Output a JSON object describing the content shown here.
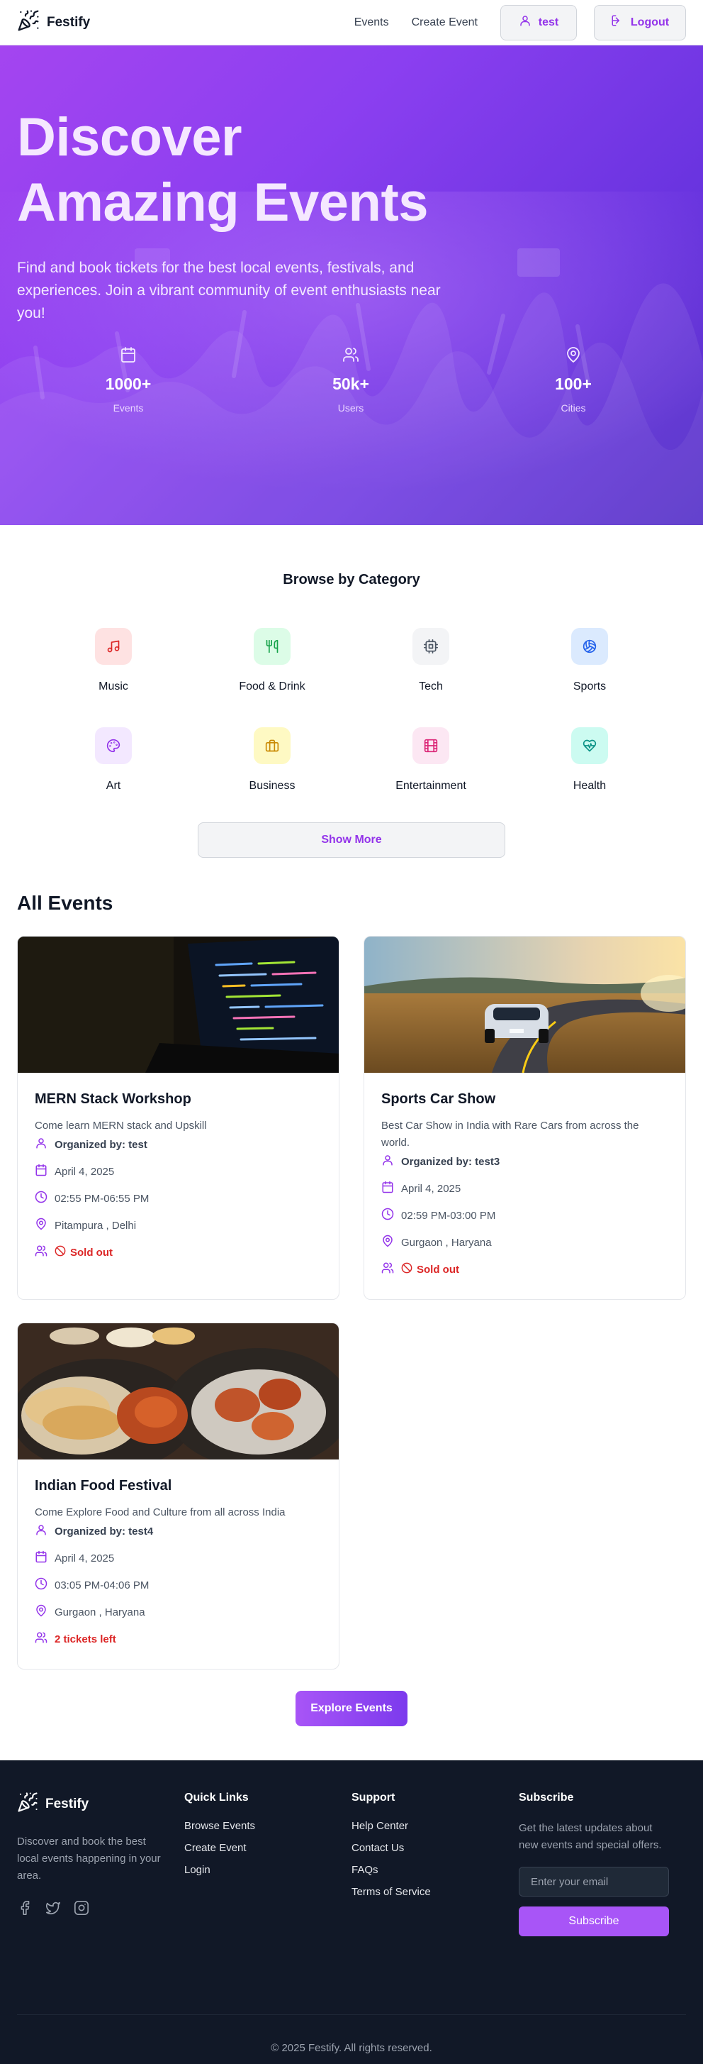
{
  "header": {
    "brand": "Festify",
    "nav": [
      "Events",
      "Create Event"
    ],
    "user_label": "test",
    "logout_label": "Logout"
  },
  "hero": {
    "title_line1": "Discover",
    "title_line2": "Amazing Events",
    "subtitle": "Find and book tickets for the best local events, festivals, and experiences. Join a vibrant community of event enthusiasts near you!",
    "stats": [
      {
        "icon": "calendar-icon",
        "value": "1000+",
        "label": "Events"
      },
      {
        "icon": "users-icon",
        "value": "50k+",
        "label": "Users"
      },
      {
        "icon": "map-pin-icon",
        "value": "100+",
        "label": "Cities"
      }
    ]
  },
  "categories": {
    "title": "Browse by Category",
    "items": [
      {
        "label": "Music",
        "icon": "music-icon",
        "bg": "#fee2e2",
        "fg": "#dc2626"
      },
      {
        "label": "Food & Drink",
        "icon": "utensils-icon",
        "bg": "#dcfce7",
        "fg": "#16a34a"
      },
      {
        "label": "Tech",
        "icon": "cpu-icon",
        "bg": "#f3f4f6",
        "fg": "#4b5563"
      },
      {
        "label": "Sports",
        "icon": "volleyball-icon",
        "bg": "#dbeafe",
        "fg": "#2563eb"
      },
      {
        "label": "Art",
        "icon": "palette-icon",
        "bg": "#f3e8ff",
        "fg": "#9333ea"
      },
      {
        "label": "Business",
        "icon": "briefcase-icon",
        "bg": "#fef9c3",
        "fg": "#ca8a04"
      },
      {
        "label": "Entertainment",
        "icon": "film-icon",
        "bg": "#fce7f3",
        "fg": "#db2777"
      },
      {
        "label": "Health",
        "icon": "heart-pulse-icon",
        "bg": "#ccfbf1",
        "fg": "#0d9488"
      }
    ],
    "show_more": "Show More"
  },
  "events": {
    "title": "All Events",
    "items": [
      {
        "title": "MERN Stack Workshop",
        "description": "Come learn MERN stack and Upskill",
        "organizer": "Organized by: test",
        "date": "April 4, 2025",
        "time": "02:55 PM-06:55 PM",
        "location": "Pitampura , Delhi",
        "availability": "Sold out",
        "sold_out": true,
        "image": "code-screen-image"
      },
      {
        "title": "Sports Car Show",
        "description": "Best Car Show in India with Rare Cars from across the world.",
        "organizer": "Organized by: test3",
        "date": "April 4, 2025",
        "time": "02:59 PM-03:00 PM",
        "location": "Gurgaon , Haryana",
        "availability": "Sold out",
        "sold_out": true,
        "image": "sports-car-image"
      },
      {
        "title": "Indian Food Festival",
        "description": "Come Explore Food and Culture from all across India",
        "organizer": "Organized by: test4",
        "date": "April 4, 2025",
        "time": "03:05 PM-04:06 PM",
        "location": "Gurgaon , Haryana",
        "availability": "2 tickets left",
        "sold_out": false,
        "image": "indian-food-image"
      }
    ],
    "explore_label": "Explore Events"
  },
  "footer": {
    "brand": "Festify",
    "description": "Discover and book the best local events happening in your area.",
    "quick_links_title": "Quick Links",
    "quick_links": [
      "Browse Events",
      "Create Event",
      "Login"
    ],
    "support_title": "Support",
    "support_links": [
      "Help Center",
      "Contact Us",
      "FAQs",
      "Terms of Service"
    ],
    "subscribe_title": "Subscribe",
    "subscribe_text": "Get the latest updates about new events and special offers.",
    "email_placeholder": "Enter your email",
    "subscribe_button": "Subscribe",
    "copyright": "© 2025 Festify. All rights reserved."
  },
  "colors": {
    "accent": "#9333ea",
    "hero_start": "#a445f0",
    "hero_end": "#4e28c6",
    "footer_bg": "#111827",
    "danger": "#dc2626"
  }
}
